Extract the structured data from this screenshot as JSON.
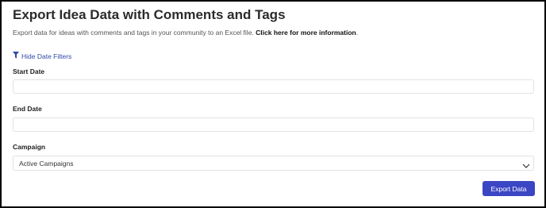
{
  "header": {
    "title": "Export Idea Data with Comments and Tags",
    "description": "Export data for ideas with comments and tags in your community to an Excel file.",
    "info_link": "Click here for more information",
    "info_link_suffix": "."
  },
  "filters": {
    "toggle_label": "Hide Date Filters",
    "toggle_icon": "funnel-icon",
    "start_date": {
      "label": "Start Date",
      "value": "",
      "placeholder": ""
    },
    "end_date": {
      "label": "End Date",
      "value": "",
      "placeholder": ""
    },
    "campaign": {
      "label": "Campaign",
      "selected": "Active Campaigns",
      "icon": "chevron-down-icon"
    }
  },
  "actions": {
    "export_label": "Export Data"
  },
  "colors": {
    "accent": "#3b46c4",
    "link": "#2f4aa8",
    "border": "#e2e2e2",
    "frame": "#000000"
  }
}
